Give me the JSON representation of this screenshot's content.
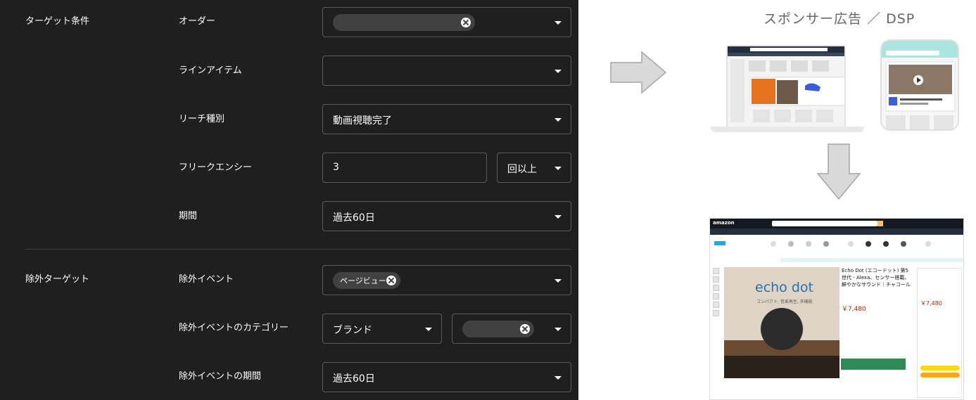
{
  "settings": {
    "target_conditions": {
      "section_label": "ターゲット条件",
      "order": {
        "label": "オーダー",
        "chip_text": ""
      },
      "line_item": {
        "label": "ラインアイテム",
        "value": ""
      },
      "reach_type": {
        "label": "リーチ種別",
        "value": "動画視聴完了"
      },
      "frequency": {
        "label": "フリークエンシー",
        "value": "3",
        "unit": "回以上"
      },
      "period": {
        "label": "期間",
        "value": "過去60日"
      }
    },
    "exclusion_target": {
      "section_label": "除外ターゲット",
      "event": {
        "label": "除外イベント",
        "chip_text": "ページビュー"
      },
      "event_category": {
        "label": "除外イベントのカテゴリー",
        "value": "ブランド",
        "chip_text": ""
      },
      "event_period": {
        "label": "除外イベントの期間",
        "value": "過去60日"
      }
    }
  },
  "diagram": {
    "title": "スポンサー広告 ／ DSP",
    "amazon_mock": {
      "logo_text": "amazon",
      "product_logo": "echo dot",
      "product_subtitle": "コンパクト, 音楽再生, 多機能",
      "product_title": "Echo Dot (エコードット) 第5世代 - Alexa、センサー搭載、鮮やかなサウンド｜チャコール",
      "price": "￥7,480",
      "buybox_price": "￥7,480"
    }
  },
  "colors": {
    "panel_background": "#1f1f1f",
    "field_border": "#5c5c5c",
    "chip_background": "#414141",
    "arrow_fill": "#d9d9d9",
    "title_color": "#666666"
  }
}
